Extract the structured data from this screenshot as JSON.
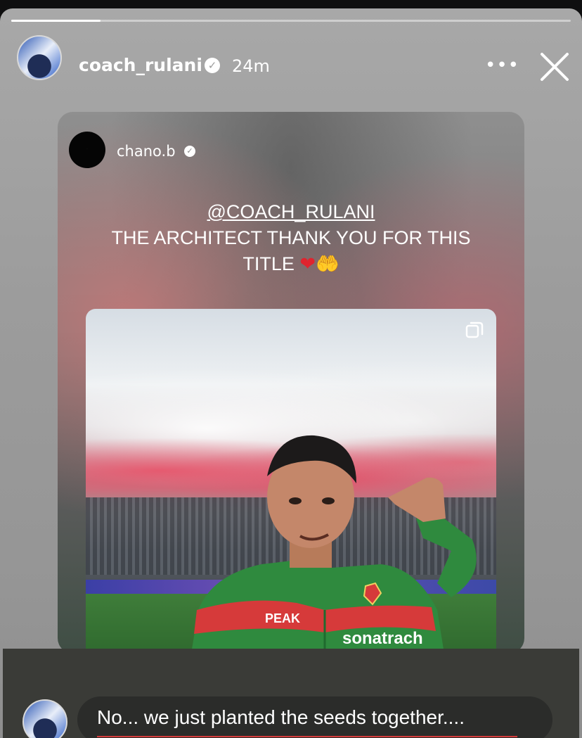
{
  "story": {
    "progress": 0.16,
    "username": "coach_rulani",
    "timestamp": "24m",
    "more_icon": "more-horizontal-icon",
    "close_icon": "close-icon"
  },
  "shared_post": {
    "username": "chano.b",
    "caption_mention": "@COACH_RULANI",
    "caption_line1": "THE ARCHITECT THANK YOU FOR THIS",
    "caption_line2": "TITLE",
    "caption_emoji_heart": "❤",
    "caption_emoji_hands": "🤲",
    "jersey_brand": "PEAK",
    "jersey_sponsor": "sonatrach"
  },
  "reply": {
    "text": "No... we just planted the seeds together...."
  },
  "colors": {
    "accent_underline": "#d53b3b",
    "jersey_green": "#2f8a3e",
    "jersey_red": "#d63a3a"
  }
}
